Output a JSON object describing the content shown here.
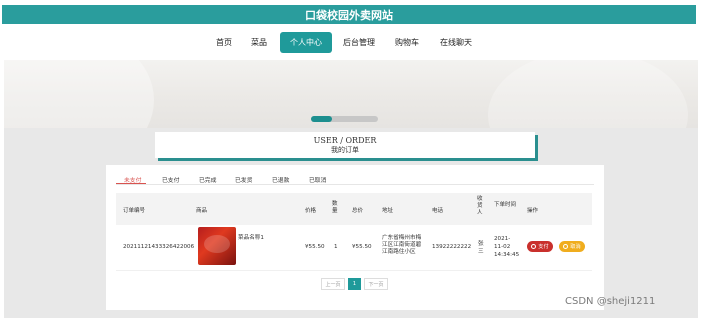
{
  "site": {
    "title": "口袋校园外卖网站"
  },
  "nav": {
    "items": [
      "首页",
      "菜品",
      "个人中心",
      "后台管理",
      "购物车",
      "在线聊天"
    ],
    "active": "个人中心"
  },
  "page": {
    "title_en": "USER / ORDER",
    "title_cn": "我的订单"
  },
  "tabs": [
    "未支付",
    "已支付",
    "已完成",
    "已发货",
    "已退款",
    "已取消"
  ],
  "table": {
    "headers": [
      "订单编号",
      "商品",
      "价格",
      "数量",
      "总价",
      "地址",
      "电话",
      "收货人",
      "下单时间",
      "操作"
    ],
    "rows": [
      {
        "order_no": "20211121433326422006",
        "product": "菜品名称1",
        "price": "¥55.50",
        "qty": "1",
        "total": "¥55.50",
        "address": "广东省梅州市梅江区江南街道碧江南路住小区",
        "phone": "13922222222",
        "receiver": "张三",
        "time": "2021-11-02 14:34:45",
        "actions": [
          "支付",
          "取消"
        ]
      }
    ]
  },
  "pagination": {
    "prev": "上一页",
    "current": "1",
    "next": "下一页"
  },
  "watermark": "CSDN @sheji1211",
  "colors": {
    "primary": "#1f9a9a",
    "danger": "#d9534f",
    "warning": "#f0ad1e"
  }
}
